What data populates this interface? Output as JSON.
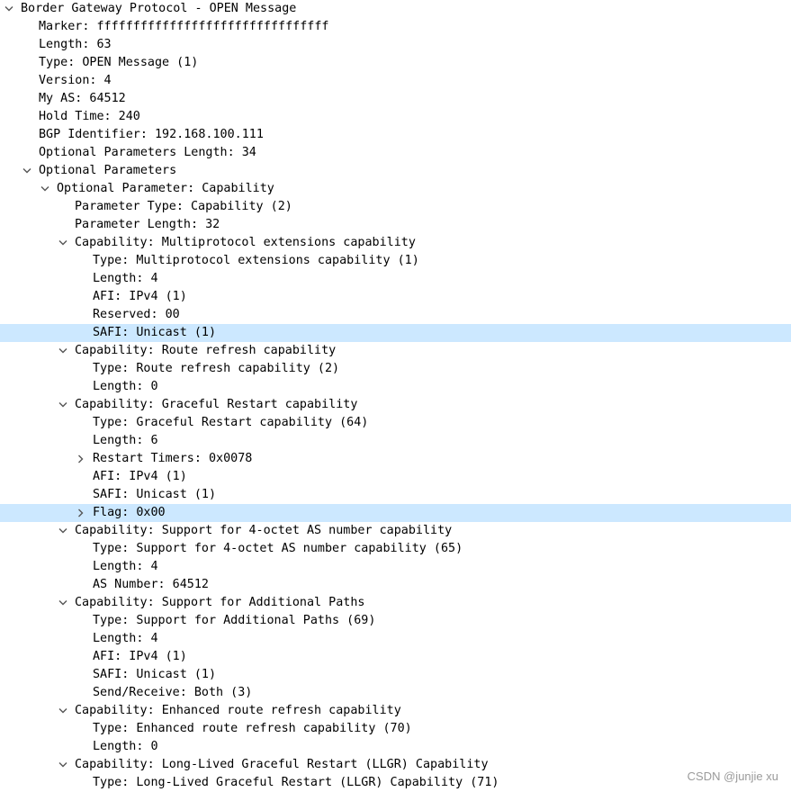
{
  "tree": [
    {
      "text": "Border Gateway Protocol - OPEN Message",
      "depth": 0,
      "toggle": "expanded",
      "selected": false
    },
    {
      "text": "Marker: ffffffffffffffffffffffffffffffff",
      "depth": 1,
      "toggle": "none",
      "selected": false
    },
    {
      "text": "Length: 63",
      "depth": 1,
      "toggle": "none",
      "selected": false
    },
    {
      "text": "Type: OPEN Message (1)",
      "depth": 1,
      "toggle": "none",
      "selected": false
    },
    {
      "text": "Version: 4",
      "depth": 1,
      "toggle": "none",
      "selected": false
    },
    {
      "text": "My AS: 64512",
      "depth": 1,
      "toggle": "none",
      "selected": false
    },
    {
      "text": "Hold Time: 240",
      "depth": 1,
      "toggle": "none",
      "selected": false
    },
    {
      "text": "BGP Identifier: 192.168.100.111",
      "depth": 1,
      "toggle": "none",
      "selected": false
    },
    {
      "text": "Optional Parameters Length: 34",
      "depth": 1,
      "toggle": "none",
      "selected": false
    },
    {
      "text": "Optional Parameters",
      "depth": 1,
      "toggle": "expanded",
      "selected": false
    },
    {
      "text": "Optional Parameter: Capability",
      "depth": 2,
      "toggle": "expanded",
      "selected": false
    },
    {
      "text": "Parameter Type: Capability (2)",
      "depth": 3,
      "toggle": "none",
      "selected": false
    },
    {
      "text": "Parameter Length: 32",
      "depth": 3,
      "toggle": "none",
      "selected": false
    },
    {
      "text": "Capability: Multiprotocol extensions capability",
      "depth": 3,
      "toggle": "expanded",
      "selected": false
    },
    {
      "text": "Type: Multiprotocol extensions capability (1)",
      "depth": 4,
      "toggle": "none",
      "selected": false
    },
    {
      "text": "Length: 4",
      "depth": 4,
      "toggle": "none",
      "selected": false
    },
    {
      "text": "AFI: IPv4 (1)",
      "depth": 4,
      "toggle": "none",
      "selected": false
    },
    {
      "text": "Reserved: 00",
      "depth": 4,
      "toggle": "none",
      "selected": false
    },
    {
      "text": "SAFI: Unicast (1)",
      "depth": 4,
      "toggle": "none",
      "selected": true
    },
    {
      "text": "Capability: Route refresh capability",
      "depth": 3,
      "toggle": "expanded",
      "selected": false
    },
    {
      "text": "Type: Route refresh capability (2)",
      "depth": 4,
      "toggle": "none",
      "selected": false
    },
    {
      "text": "Length: 0",
      "depth": 4,
      "toggle": "none",
      "selected": false
    },
    {
      "text": "Capability: Graceful Restart capability",
      "depth": 3,
      "toggle": "expanded",
      "selected": false
    },
    {
      "text": "Type: Graceful Restart capability (64)",
      "depth": 4,
      "toggle": "none",
      "selected": false
    },
    {
      "text": "Length: 6",
      "depth": 4,
      "toggle": "none",
      "selected": false
    },
    {
      "text": "Restart Timers: 0x0078",
      "depth": 4,
      "toggle": "collapsed",
      "selected": false
    },
    {
      "text": "AFI: IPv4 (1)",
      "depth": 4,
      "toggle": "none",
      "selected": false
    },
    {
      "text": "SAFI: Unicast (1)",
      "depth": 4,
      "toggle": "none",
      "selected": false
    },
    {
      "text": "Flag: 0x00",
      "depth": 4,
      "toggle": "collapsed",
      "selected": true
    },
    {
      "text": "Capability: Support for 4-octet AS number capability",
      "depth": 3,
      "toggle": "expanded",
      "selected": false
    },
    {
      "text": "Type: Support for 4-octet AS number capability (65)",
      "depth": 4,
      "toggle": "none",
      "selected": false
    },
    {
      "text": "Length: 4",
      "depth": 4,
      "toggle": "none",
      "selected": false
    },
    {
      "text": "AS Number: 64512",
      "depth": 4,
      "toggle": "none",
      "selected": false
    },
    {
      "text": "Capability: Support for Additional Paths",
      "depth": 3,
      "toggle": "expanded",
      "selected": false
    },
    {
      "text": "Type: Support for Additional Paths (69)",
      "depth": 4,
      "toggle": "none",
      "selected": false
    },
    {
      "text": "Length: 4",
      "depth": 4,
      "toggle": "none",
      "selected": false
    },
    {
      "text": "AFI: IPv4 (1)",
      "depth": 4,
      "toggle": "none",
      "selected": false
    },
    {
      "text": "SAFI: Unicast (1)",
      "depth": 4,
      "toggle": "none",
      "selected": false
    },
    {
      "text": "Send/Receive: Both (3)",
      "depth": 4,
      "toggle": "none",
      "selected": false
    },
    {
      "text": "Capability: Enhanced route refresh capability",
      "depth": 3,
      "toggle": "expanded",
      "selected": false
    },
    {
      "text": "Type: Enhanced route refresh capability (70)",
      "depth": 4,
      "toggle": "none",
      "selected": false
    },
    {
      "text": "Length: 0",
      "depth": 4,
      "toggle": "none",
      "selected": false
    },
    {
      "text": "Capability: Long-Lived Graceful Restart (LLGR) Capability",
      "depth": 3,
      "toggle": "expanded",
      "selected": false
    },
    {
      "text": "Type: Long-Lived Graceful Restart (LLGR) Capability (71)",
      "depth": 4,
      "toggle": "none",
      "selected": false
    }
  ],
  "icons": {
    "expanded": "chevron-down-icon",
    "collapsed": "chevron-right-icon"
  },
  "colors": {
    "selected_row": "#cce8ff",
    "chevron": "#555555",
    "watermark": "#9a9a9a"
  },
  "watermark": "CSDN @junjie xu"
}
